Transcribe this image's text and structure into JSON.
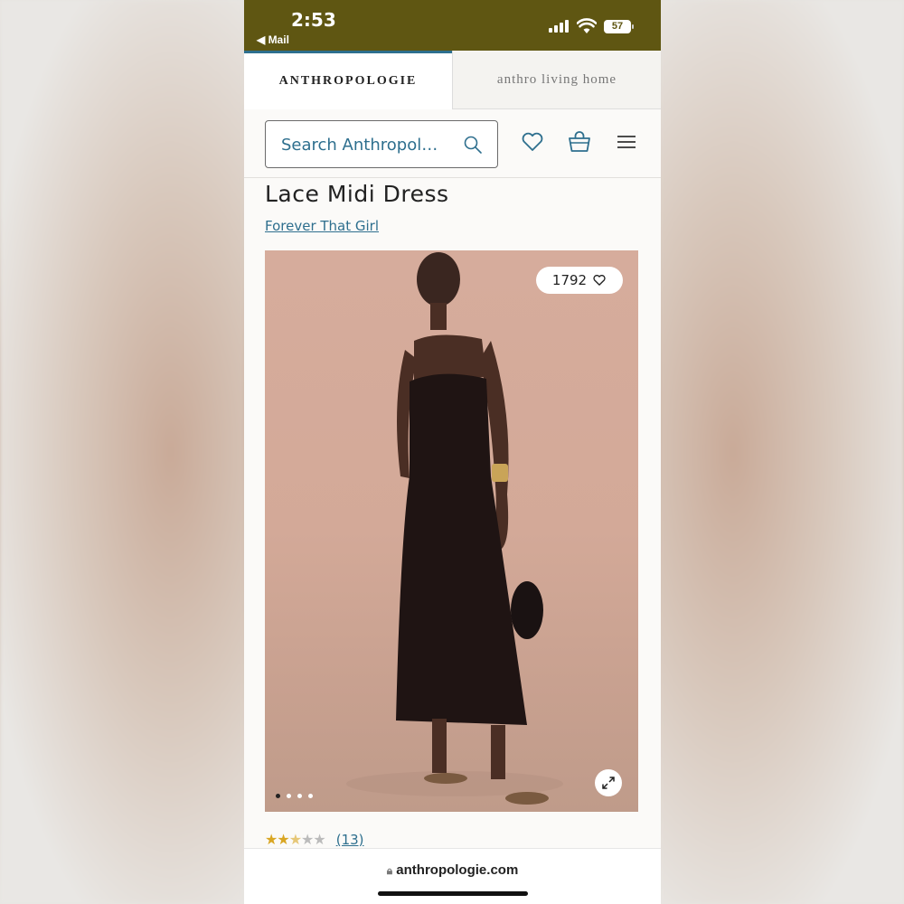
{
  "status_bar": {
    "time": "2:53",
    "back_label": "◀ Mail",
    "battery": "57"
  },
  "brand_tabs": [
    {
      "label": "ANTHROPOLOGIE",
      "active": true
    },
    {
      "label": "anthro living home",
      "active": false
    }
  ],
  "search": {
    "placeholder": "Search Anthropol…"
  },
  "header_icons": [
    "heart-icon",
    "shopping-bag-icon",
    "menu-icon"
  ],
  "product": {
    "title": "Lace Midi Dress",
    "brand": "Forever That Girl",
    "likes": "1792",
    "image_count": 4,
    "active_image": 0,
    "rating": 2.5,
    "review_count": "(13)"
  },
  "browser": {
    "url": "anthropologie.com"
  },
  "colors": {
    "status_bar": "#5f5612",
    "accent": "#2e6f8e",
    "star": "#d9a623"
  }
}
